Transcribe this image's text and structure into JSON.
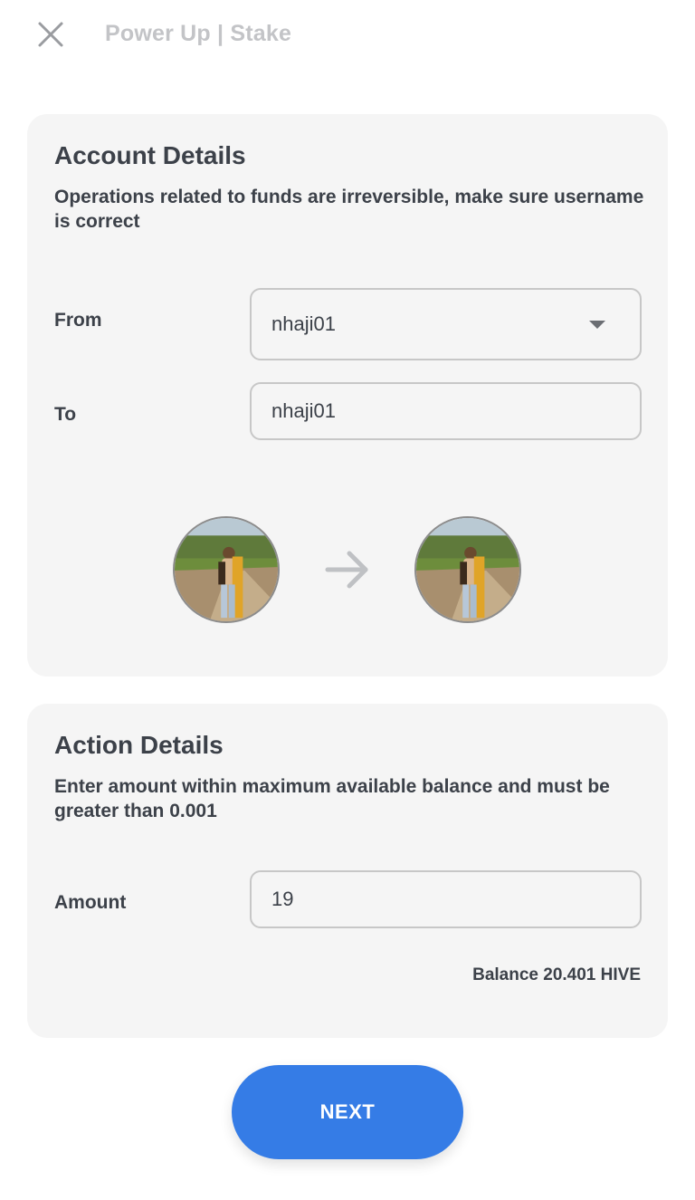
{
  "header": {
    "title": "Power Up | Stake",
    "close_icon": "close-icon"
  },
  "account_details": {
    "title": "Account Details",
    "description": "Operations related to funds are irreversible, make sure username is correct",
    "from_label": "From",
    "from_value": "nhaji01",
    "to_label": "To",
    "to_value": "nhaji01",
    "arrow_icon": "arrow-right-icon"
  },
  "action_details": {
    "title": "Action Details",
    "description": "Enter amount within maximum available balance  and must be greater than 0.001",
    "amount_label": "Amount",
    "amount_value": "19",
    "balance": "Balance 20.401 HIVE"
  },
  "footer": {
    "next_label": "NEXT"
  },
  "colors": {
    "accent": "#357ce6",
    "card_bg": "#f5f5f5",
    "text": "#3c4149",
    "muted": "#c3c4c7"
  }
}
